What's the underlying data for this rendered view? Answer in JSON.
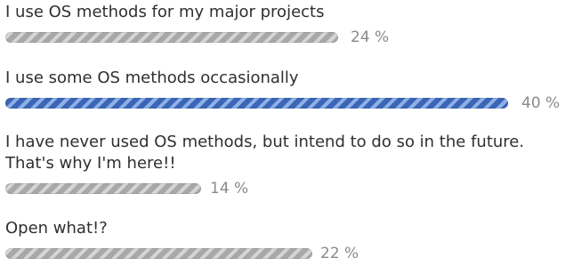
{
  "poll": {
    "options": [
      {
        "label": "I use OS methods for my major projects",
        "percent_text": "24 %",
        "percent": 24,
        "color": "#a8a8a8",
        "highlighted": false
      },
      {
        "label": "I use some OS methods occasionally",
        "percent_text": "40 %",
        "percent": 40,
        "color": "#3b66b7",
        "highlighted": true
      },
      {
        "label": "I have never used OS methods, but intend to do so in the future. That's why I'm here!!",
        "percent_text": "14 %",
        "percent": 14,
        "color": "#a8a8a8",
        "highlighted": false
      },
      {
        "label": "Open what!?",
        "percent_text": "22 %",
        "percent": 22,
        "color": "#a8a8a8",
        "highlighted": false
      }
    ]
  }
}
